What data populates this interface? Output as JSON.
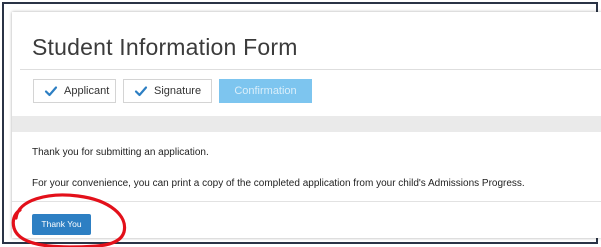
{
  "form": {
    "title": "Student Information Form"
  },
  "steps": [
    {
      "label": "Applicant",
      "state": "completed",
      "icon": "check-icon"
    },
    {
      "label": "Signature",
      "state": "completed",
      "icon": "check-icon"
    },
    {
      "label": "Confirmation",
      "state": "current"
    }
  ],
  "confirmation": {
    "message_1": "Thank you for submitting an application.",
    "message_2": "For your convenience, you can print a copy of the completed application from your child's Admissions Progress."
  },
  "actions": {
    "thank_you_label": "Thank You"
  },
  "colors": {
    "accent": "#2d7fc3",
    "step_current": "#7dc5ef",
    "check": "#2d7fc3",
    "highlight_circle": "#e3101a",
    "frame_border": "#2a3346"
  }
}
